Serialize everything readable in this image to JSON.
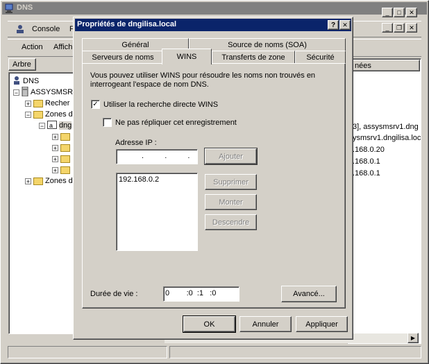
{
  "main_window": {
    "title": "DNS",
    "menu": {
      "console": "Console",
      "file_partial": "F"
    },
    "toolbar": {
      "action": "Action",
      "view_partial": "Affich"
    },
    "tree_tab": "Arbre",
    "column_names": "nées",
    "tree": [
      {
        "label": "DNS"
      },
      {
        "label": "ASSYSMSR"
      },
      {
        "label": "Recher"
      },
      {
        "label": "Zones d"
      },
      {
        "label": "dng"
      },
      {
        "label": "Zones d"
      }
    ],
    "list_values": [
      "3], assysmsrv1.dng",
      "ysmsrv1.dngilisa.loc",
      ".168.0.20",
      ".168.0.1",
      ".168.0.1"
    ]
  },
  "dialog": {
    "title": "Propriétés de dngilisa.local",
    "tabs_back": [
      "Général",
      "Source de noms (SOA)"
    ],
    "tabs_front": [
      "Serveurs de noms",
      "WINS",
      "Transferts de zone",
      "Sécurité"
    ],
    "description": "Vous pouvez utiliser WINS pour résoudre les noms non trouvés en interrogeant l'espace de nom DNS.",
    "checkbox_wins": {
      "label": "Utiliser la recherche directe WINS",
      "checked": true
    },
    "checkbox_norep": {
      "label": "Ne pas répliquer cet enregistrement",
      "checked": false
    },
    "ip_label": "Adresse IP :",
    "ip_value": " .  .  .",
    "btn_add": "Ajouter",
    "ip_list": [
      "192.168.0.2"
    ],
    "btn_remove": "Supprimer",
    "btn_up": "Monter",
    "btn_down": "Descendre",
    "ttl_label": "Durée de vie :",
    "ttl_value": "0        :0  :1   :0",
    "btn_advanced": "Avancé...",
    "btn_ok": "OK",
    "btn_cancel": "Annuler",
    "btn_apply": "Appliquer",
    "help_glyph": "?",
    "close_glyph": "✕"
  }
}
